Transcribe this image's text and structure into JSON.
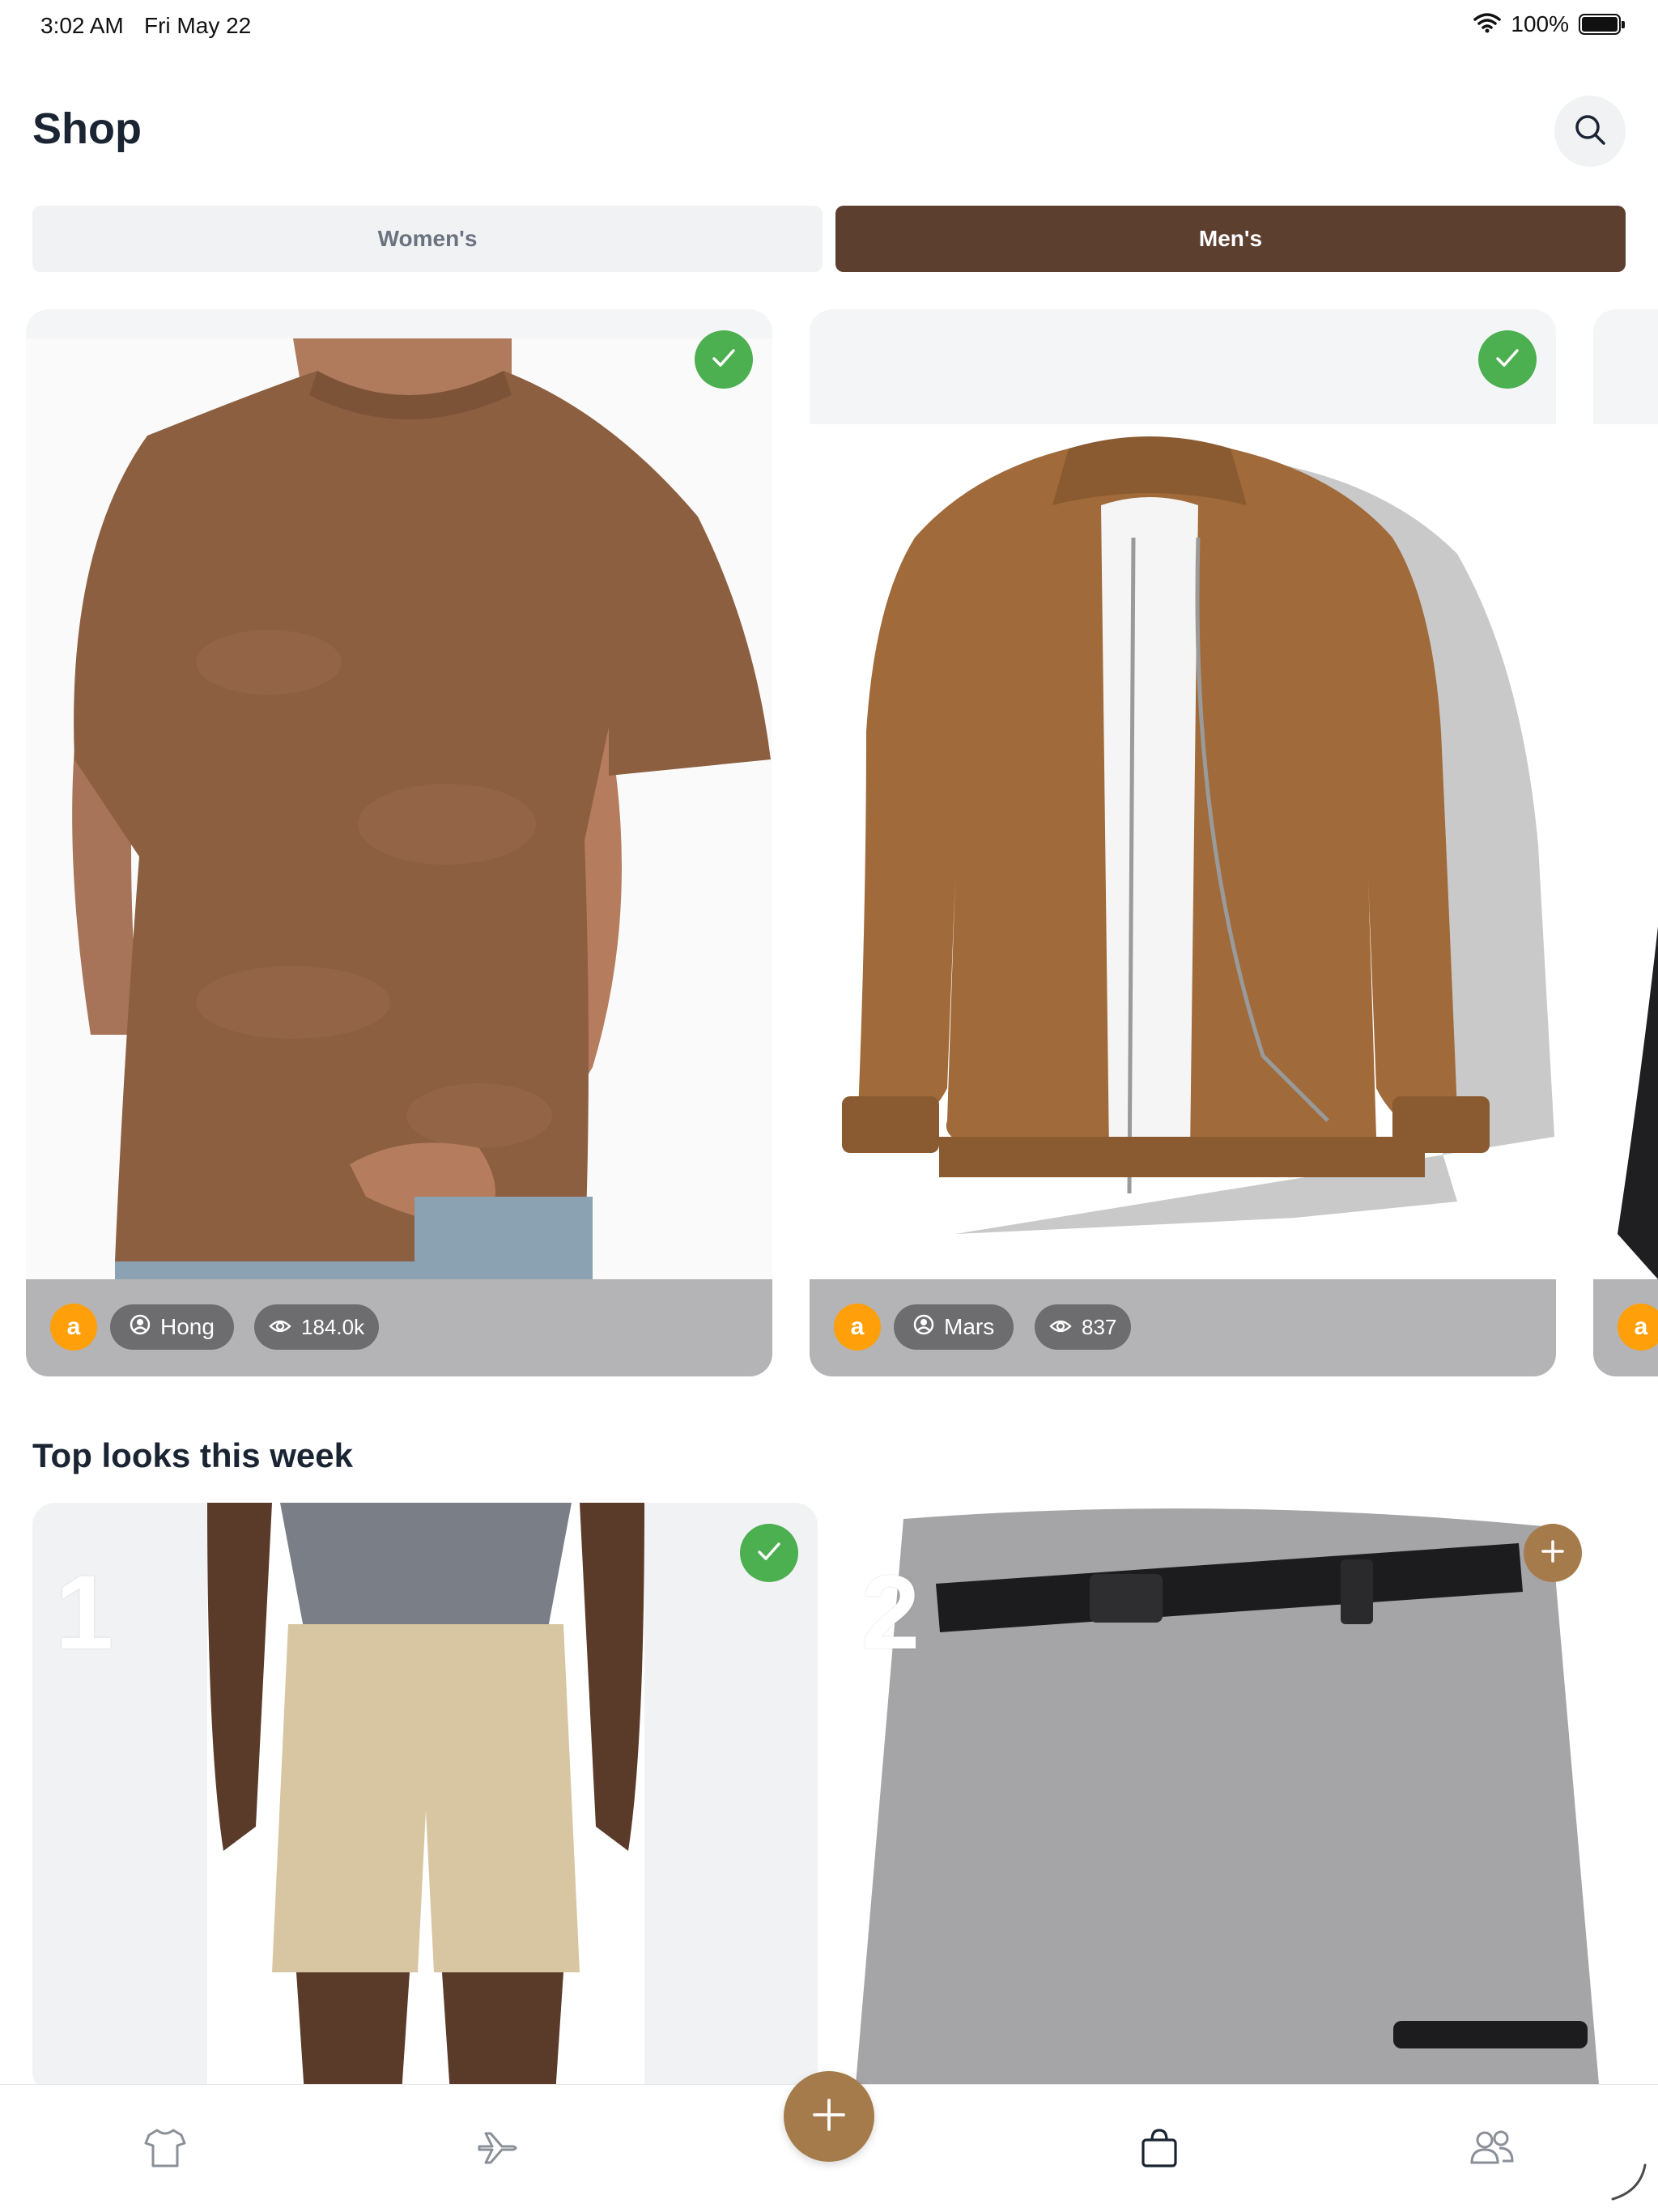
{
  "status_bar": {
    "time": "3:02 AM",
    "date": "Fri May 22",
    "battery": "100%"
  },
  "header": {
    "title": "Shop"
  },
  "tabs": [
    {
      "label": "Women's",
      "selected": false
    },
    {
      "label": "Men's",
      "selected": true
    }
  ],
  "products": [
    {
      "amazon_glyph": "a",
      "author": "Hong",
      "views": "184.0k"
    },
    {
      "amazon_glyph": "a",
      "author": "Mars",
      "views": "837"
    },
    {
      "amazon_glyph": "a"
    }
  ],
  "top_looks": {
    "title": "Top looks this week",
    "items": [
      {
        "rank": "1"
      },
      {
        "rank": "2"
      }
    ]
  },
  "colors": {
    "accent_brown": "#5d3f30",
    "fab_brown": "#a67b4b",
    "check_green": "#4caf50",
    "amazon_orange": "#ff9f0a"
  },
  "icons": {
    "tab_bar": [
      "shirt-icon",
      "plane-icon",
      "plus-icon",
      "bag-icon",
      "people-icon"
    ]
  }
}
